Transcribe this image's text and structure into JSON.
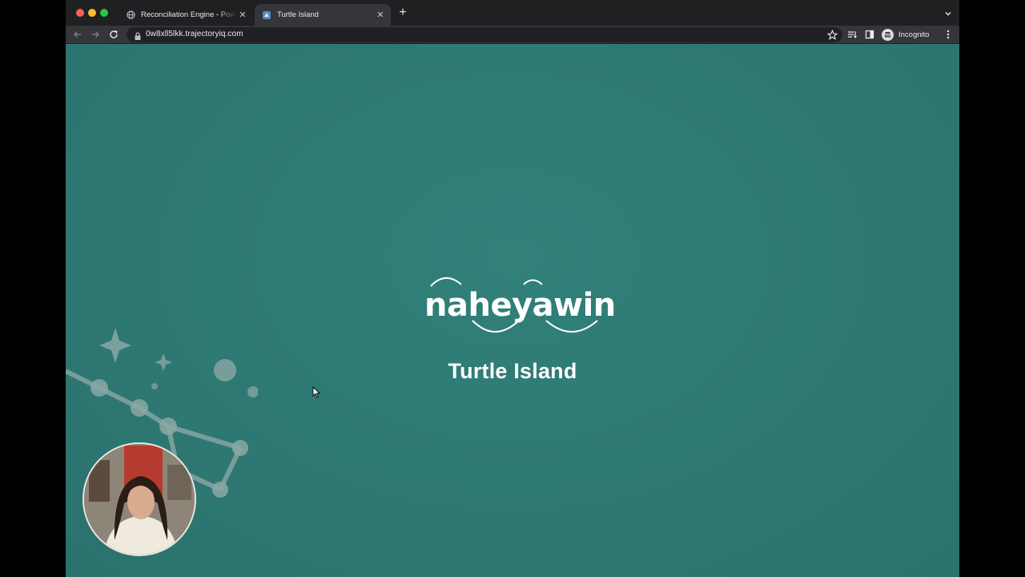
{
  "browser": {
    "tabs": [
      {
        "title": "Reconciliation Engine - Powered by TrajectoryIQ",
        "favicon": "globe-icon",
        "active": false
      },
      {
        "title": "Turtle Island",
        "favicon": "site-favicon-icon",
        "active": true
      }
    ],
    "url": "0w8xll5lkk.trajectoryiq.com",
    "profile_label": "Incognito",
    "colors": {
      "tabstrip": "#1f2022",
      "toolbar": "#35363a",
      "page_bg": "#2f7b76"
    }
  },
  "page": {
    "logo_text": "naheyawin",
    "title": "Turtle Island"
  },
  "overlay": {
    "webcam": "presenter-video"
  }
}
